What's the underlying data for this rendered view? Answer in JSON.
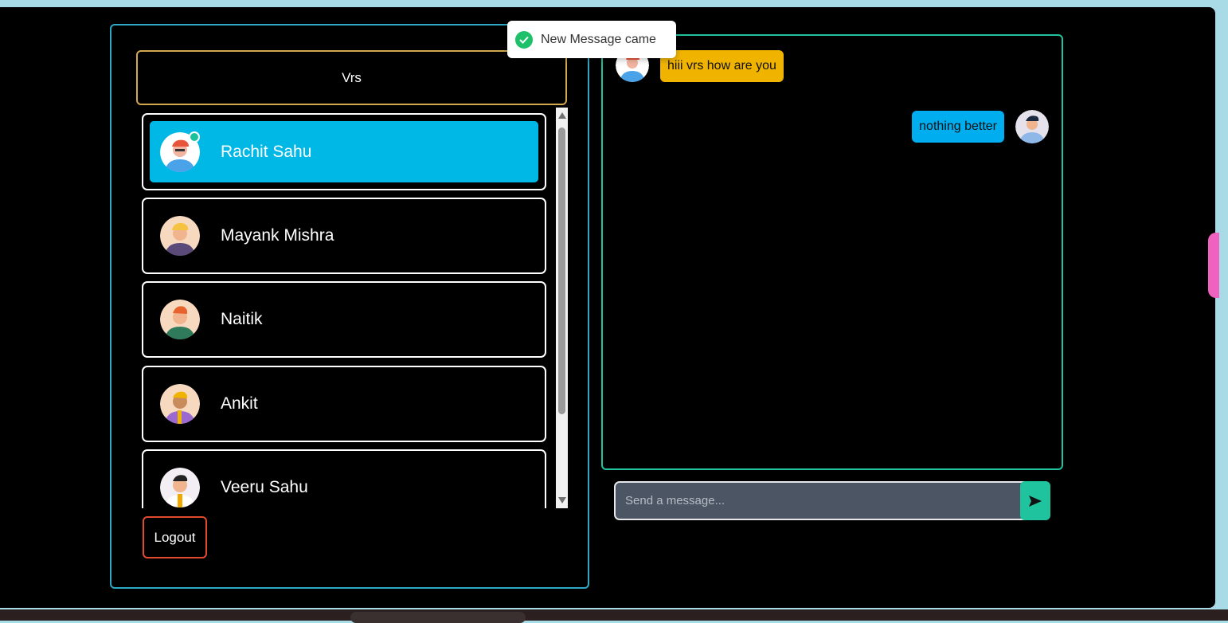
{
  "current_user": {
    "name": "Vrs"
  },
  "contacts": [
    {
      "name": "Rachit Sahu",
      "active": true,
      "online": true
    },
    {
      "name": "Mayank Mishra",
      "active": false
    },
    {
      "name": "Naitik",
      "active": false
    },
    {
      "name": "Ankit",
      "active": false
    },
    {
      "name": "Veeru Sahu",
      "active": false
    }
  ],
  "logout_label": "Logout",
  "messages": [
    {
      "direction": "received",
      "text": "hiii vrs how are you"
    },
    {
      "direction": "sent",
      "text": "nothing better"
    }
  ],
  "composer": {
    "placeholder": "Send a message...",
    "send_icon": "send-arrow-icon"
  },
  "toast": {
    "text": "New Message came",
    "icon": "check-circle-icon"
  },
  "colors": {
    "accent_cyan": "#00b8e6",
    "accent_green": "#1fc39d",
    "received_bubble": "#f0b400",
    "sent_bubble": "#00adef",
    "logout_border": "#e24a2d"
  }
}
